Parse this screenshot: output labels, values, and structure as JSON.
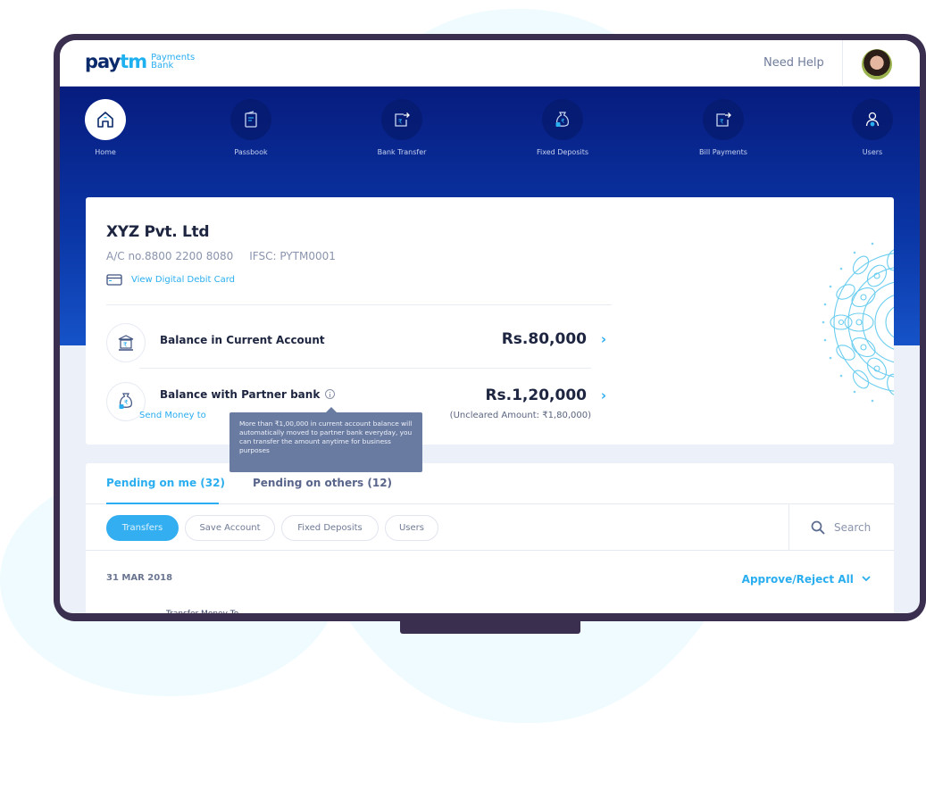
{
  "header": {
    "logo_main_left": "pay",
    "logo_main_right": "tm",
    "logo_sub_line1": "Payments",
    "logo_sub_line2": "Bank",
    "need_help": "Need Help",
    "avatar_alt": "user-avatar"
  },
  "nav": {
    "items": [
      {
        "label": "Home",
        "icon": "home-icon",
        "active": true
      },
      {
        "label": "Passbook",
        "icon": "passbook-icon",
        "active": false
      },
      {
        "label": "Bank Transfer",
        "icon": "bank-transfer-icon",
        "active": false
      },
      {
        "label": "Fixed Deposits",
        "icon": "money-bag-icon",
        "active": false
      },
      {
        "label": "Bill Payments",
        "icon": "bill-payment-icon",
        "active": false
      },
      {
        "label": "Users",
        "icon": "user-settings-icon",
        "active": false
      }
    ]
  },
  "account": {
    "company": "XYZ Pvt. Ltd",
    "account_no": "A/C no.8800 2200 8080",
    "ifsc": "IFSC: PYTM0001",
    "debit_card_link": "View Digital Debit Card",
    "balances": [
      {
        "title": "Balance in Current Account",
        "amount": "Rs.80,000",
        "icon": "bank-rupee-icon"
      },
      {
        "title": "Balance with Partner bank",
        "amount": "Rs.1,20,000",
        "icon": "money-bag-lock-icon",
        "link": "Send Money to",
        "note": "(Uncleared Amount: ₹1,80,000)"
      }
    ],
    "tooltip": "More than ₹1,00,000 in current account balance will automatically moved to partner bank everyday, you can transfer the amount anytime for business purposes"
  },
  "pending": {
    "tabs": [
      {
        "label": "Pending on me (32)",
        "active": true
      },
      {
        "label": "Pending on others (12)",
        "active": false
      }
    ],
    "filters": [
      {
        "label": "Transfers",
        "active": true
      },
      {
        "label": "Save Account",
        "active": false
      },
      {
        "label": "Fixed Deposits",
        "active": false
      },
      {
        "label": "Users",
        "active": false
      }
    ],
    "search_label": "Search",
    "date": "31 MAR 2018",
    "approve_all": "Approve/Reject All",
    "first_row_title": "Transfer Money To"
  },
  "colors": {
    "brand_dark": "#0b2a6b",
    "accent": "#2aaef0",
    "hero_top": "#071c7e",
    "hero_bottom": "#1553c8",
    "device_frame": "#3b2f4f",
    "tooltip_bg": "#6a7ba1"
  }
}
